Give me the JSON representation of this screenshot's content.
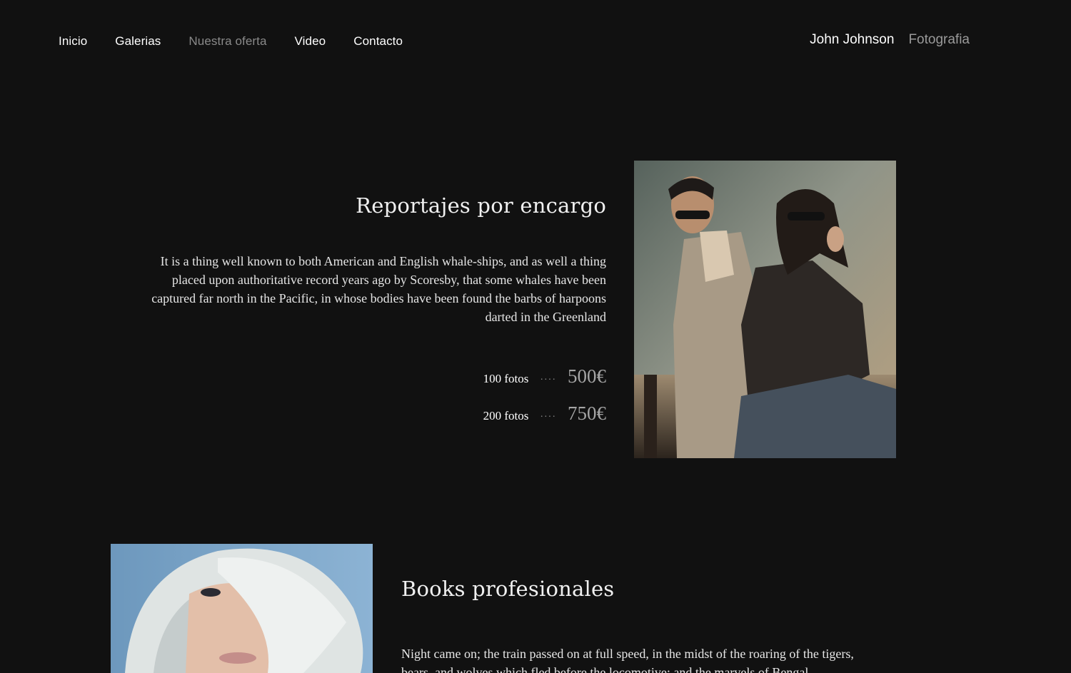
{
  "nav": {
    "items": [
      {
        "label": "Inicio",
        "active": false
      },
      {
        "label": "Galerias",
        "active": false
      },
      {
        "label": "Nuestra oferta",
        "active": true
      },
      {
        "label": "Video",
        "active": false
      },
      {
        "label": "Contacto",
        "active": false
      }
    ]
  },
  "brand": {
    "name": "John Johnson",
    "tagline": "Fotografia"
  },
  "section1": {
    "title": "Reportajes por encargo",
    "body": "It is a thing well known to both American and English whale-ships, and as well a thing placed upon authoritative record years ago by Scoresby, that some whales have been captured far north in the Pacific, in whose bodies have been found the barbs of harpoons darted in the Greenland",
    "prices": [
      {
        "label": "100 fotos",
        "dots": "····",
        "value": "500€"
      },
      {
        "label": "200 fotos",
        "dots": "····",
        "value": "750€"
      }
    ]
  },
  "section2": {
    "title": "Books profesionales",
    "body": "Night came on; the train passed on at full speed, in the midst of the roaring of the tigers, bears, and wolves which fled before the locomotive; and the marvels of Bengal,"
  },
  "colors": {
    "background": "#111111",
    "text": "#ffffff",
    "muted": "#8a8a8a",
    "price": "#a5a5a5"
  }
}
